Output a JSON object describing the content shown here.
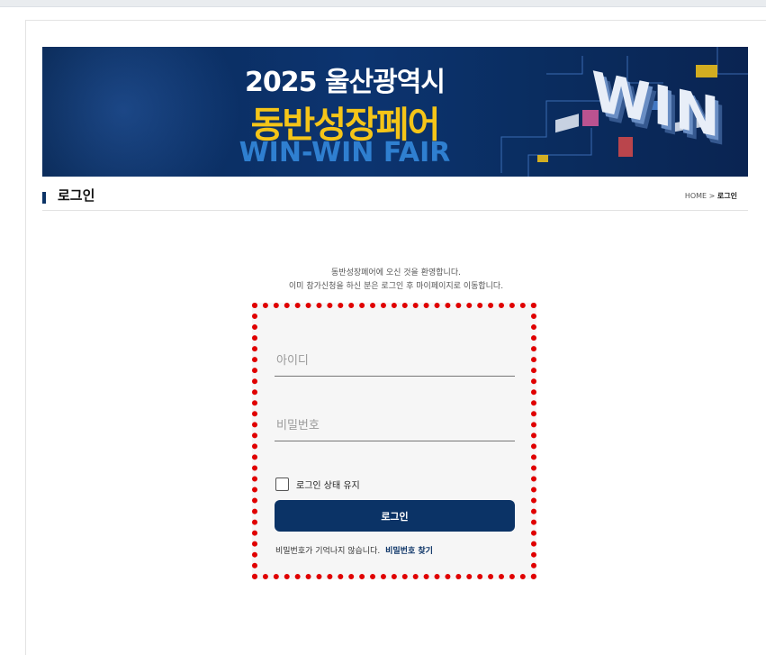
{
  "banner": {
    "year_title": "2025 울산광역시",
    "main_title": "동반성장페어",
    "sub_title": "WIN-WIN FAIR",
    "win_text": "WIN"
  },
  "section": {
    "title": "로그인",
    "breadcrumb_home": "HOME",
    "breadcrumb_sep": ">",
    "breadcrumb_current": "로그인"
  },
  "welcome": {
    "line1": "동반성장페어에 오신 것을 환영합니다.",
    "line2": "이미 참가신청을 하신 분은 로그인 후 마이페이지로 이동합니다."
  },
  "form": {
    "id_placeholder": "아이디",
    "password_placeholder": "비밀번호",
    "remember_label": "로그인 상태 유지",
    "login_button": "로그인",
    "forgot_text": "비밀번호가 기억나지 않습니다.",
    "forgot_link": "비밀번호 찾기"
  },
  "colors": {
    "brand_navy": "#0b3366",
    "highlight_red": "#e00000",
    "banner_yellow": "#f5c518",
    "banner_blue_text": "#2f7fd0"
  }
}
